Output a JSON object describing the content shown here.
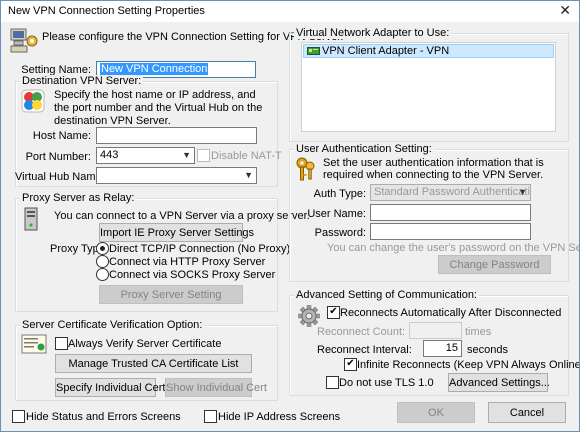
{
  "window": {
    "title": "New VPN Connection Setting Properties",
    "close_glyph": "✕"
  },
  "intro": {
    "text": "Please configure the VPN Connection Setting for VPN Server."
  },
  "setting_name": {
    "label": "Setting Name:",
    "value": "New VPN Connection"
  },
  "destination": {
    "group_label": "Destination VPN Server:",
    "description": "Specify the host name or IP address, and the port number and the Virtual Hub on the destination VPN Server.",
    "host_name_label": "Host Name:",
    "host_name_value": "",
    "port_label": "Port Number:",
    "port_value": "443",
    "disable_natt_label": "Disable NAT-T",
    "virtual_hub_label": "Virtual Hub Name:",
    "virtual_hub_value": ""
  },
  "proxy": {
    "group_label": "Proxy Server as Relay:",
    "description": "You can connect to a VPN Server via a proxy server.",
    "import_button": "Import IE Proxy Server Settings",
    "type_label": "Proxy Type:",
    "options": [
      "Direct TCP/IP Connection (No Proxy)",
      "Connect via HTTP Proxy Server",
      "Connect via SOCKS Proxy Server"
    ],
    "selected_index": 0,
    "setting_button": "Proxy Server Setting"
  },
  "certificate": {
    "group_label": "Server Certificate Verification Option:",
    "always_verify_label": "Always Verify Server Certificate",
    "manage_button": "Manage Trusted CA Certificate List",
    "specify_button": "Specify Individual Cert",
    "show_button": "Show Individual Cert"
  },
  "adapter": {
    "group_label": "Virtual Network Adapter to Use:",
    "items": [
      "VPN Client Adapter - VPN"
    ]
  },
  "auth": {
    "group_label": "User Authentication Setting:",
    "description": "Set the user authentication information that is required when connecting to the VPN Server.",
    "type_label": "Auth Type:",
    "type_value": "Standard Password Authentication",
    "username_label": "User Name:",
    "username_value": "",
    "password_label": "Password:",
    "password_value": "",
    "hint": "You can change the user's password on the VPN Server.",
    "change_password_button": "Change Password"
  },
  "advanced": {
    "group_label": "Advanced Setting of Communication:",
    "reconnect_label": "Reconnects Automatically After Disconnected",
    "reconnect_count_label": "Reconnect Count:",
    "reconnect_count_value": "",
    "times_label": "times",
    "interval_label": "Reconnect Interval:",
    "interval_value": "15",
    "seconds_label": "seconds",
    "infinite_label": "Infinite Reconnects (Keep VPN Always Online)",
    "no_tls_label": "Do not use TLS 1.0",
    "advanced_button": "Advanced Settings..."
  },
  "footer": {
    "hide_status_label": "Hide Status and Errors Screens",
    "hide_ip_label": "Hide IP Address Screens",
    "ok_button": "OK",
    "cancel_button": "Cancel"
  },
  "checks": {
    "disable_natt": false,
    "always_verify": false,
    "reconnect_auto": true,
    "infinite": true,
    "no_tls": false,
    "hide_status": false,
    "hide_ip": false
  },
  "check_glyph": "✔"
}
